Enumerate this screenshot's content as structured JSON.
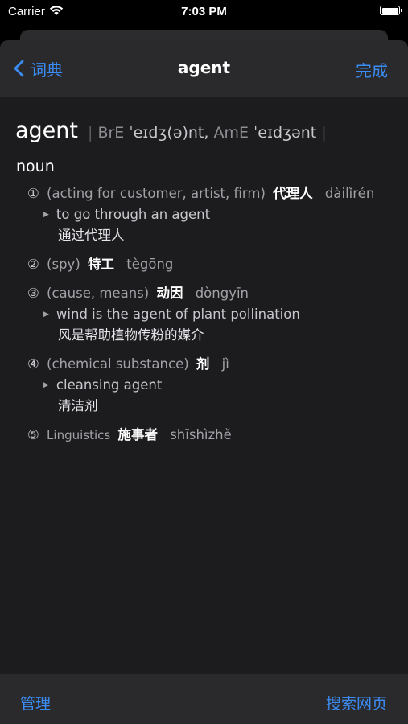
{
  "status_bar": {
    "carrier": "Carrier",
    "time": "7:03 PM"
  },
  "nav": {
    "back_label": "词典",
    "title": "agent",
    "done_label": "完成"
  },
  "entry": {
    "headword": "agent",
    "bre_label": "BrE",
    "bre_ipa": "ˈeɪdʒ(ə)nt,",
    "ame_label": "AmE",
    "ame_ipa": "ˈeɪdʒənt",
    "bar": "|",
    "part_of_speech": "noun",
    "senses": [
      {
        "num": "①",
        "gloss": "(acting for customer, artist, firm)",
        "zh": "代理人",
        "pinyin": "dàilǐrén",
        "example_en": "to go through an agent",
        "example_zh": "通过代理人"
      },
      {
        "num": "②",
        "gloss": "(spy)",
        "zh": "特工",
        "pinyin": "tègōng"
      },
      {
        "num": "③",
        "gloss": "(cause, means)",
        "zh": "动因",
        "pinyin": "dòngyīn",
        "example_en": "wind is the agent of plant pollination",
        "example_zh": "风是帮助植物传粉的媒介"
      },
      {
        "num": "④",
        "gloss": "(chemical substance)",
        "zh": "剂",
        "pinyin": "jì",
        "example_en": "cleansing agent",
        "example_zh": "清洁剂"
      },
      {
        "num": "⑤",
        "gloss": "Linguistics",
        "zh": "施事者",
        "pinyin": "shīshìzhě"
      }
    ]
  },
  "toolbar": {
    "manage_label": "管理",
    "search_web_label": "搜索网页"
  },
  "icons": {
    "back": "chevron-left-icon",
    "wifi": "wifi-icon",
    "battery": "battery-icon",
    "example_marker": "triangle-right-icon"
  },
  "colors": {
    "accent": "#3b8cf5",
    "background": "#1c1c1e",
    "bar_background": "#2a2a2c"
  }
}
